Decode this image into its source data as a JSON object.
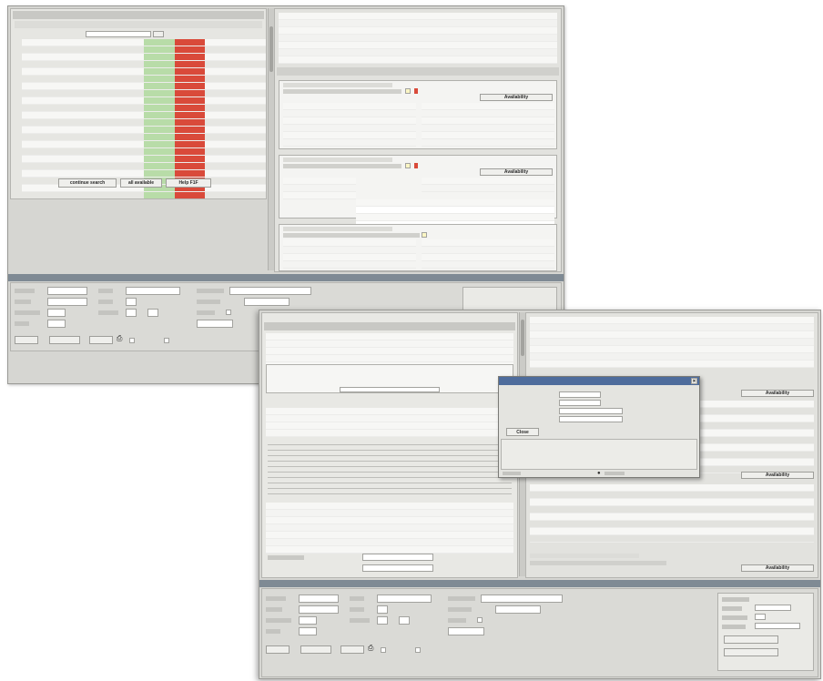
{
  "left_window": {
    "title": "",
    "results": {
      "header_title": "",
      "columns": [
        "",
        "",
        "",
        "",
        "",
        "",
        ""
      ],
      "row_count": 24,
      "buttons": {
        "continue": "continue search",
        "all": "all available",
        "help": "Help F1F"
      }
    },
    "flights": {
      "box_titles": [
        "",
        "",
        ""
      ],
      "availability_label": "Availability"
    },
    "booking": {
      "section_title": "",
      "buttons": [
        "",
        "",
        ""
      ],
      "checkbox_labels": [
        "",
        ""
      ]
    }
  },
  "right_window": {
    "alert_lines": [
      "",
      "",
      ""
    ],
    "price_table_headers": [
      "",
      "",
      "",
      "",
      ""
    ],
    "form_headers": [
      "",
      "",
      "",
      "",
      ""
    ],
    "dialog": {
      "title": "",
      "labels": [
        "",
        "",
        "",
        ""
      ],
      "close_label": "Close"
    },
    "availability_label": "Availability",
    "sidebar_labels": [
      "",
      "",
      "",
      ""
    ]
  }
}
